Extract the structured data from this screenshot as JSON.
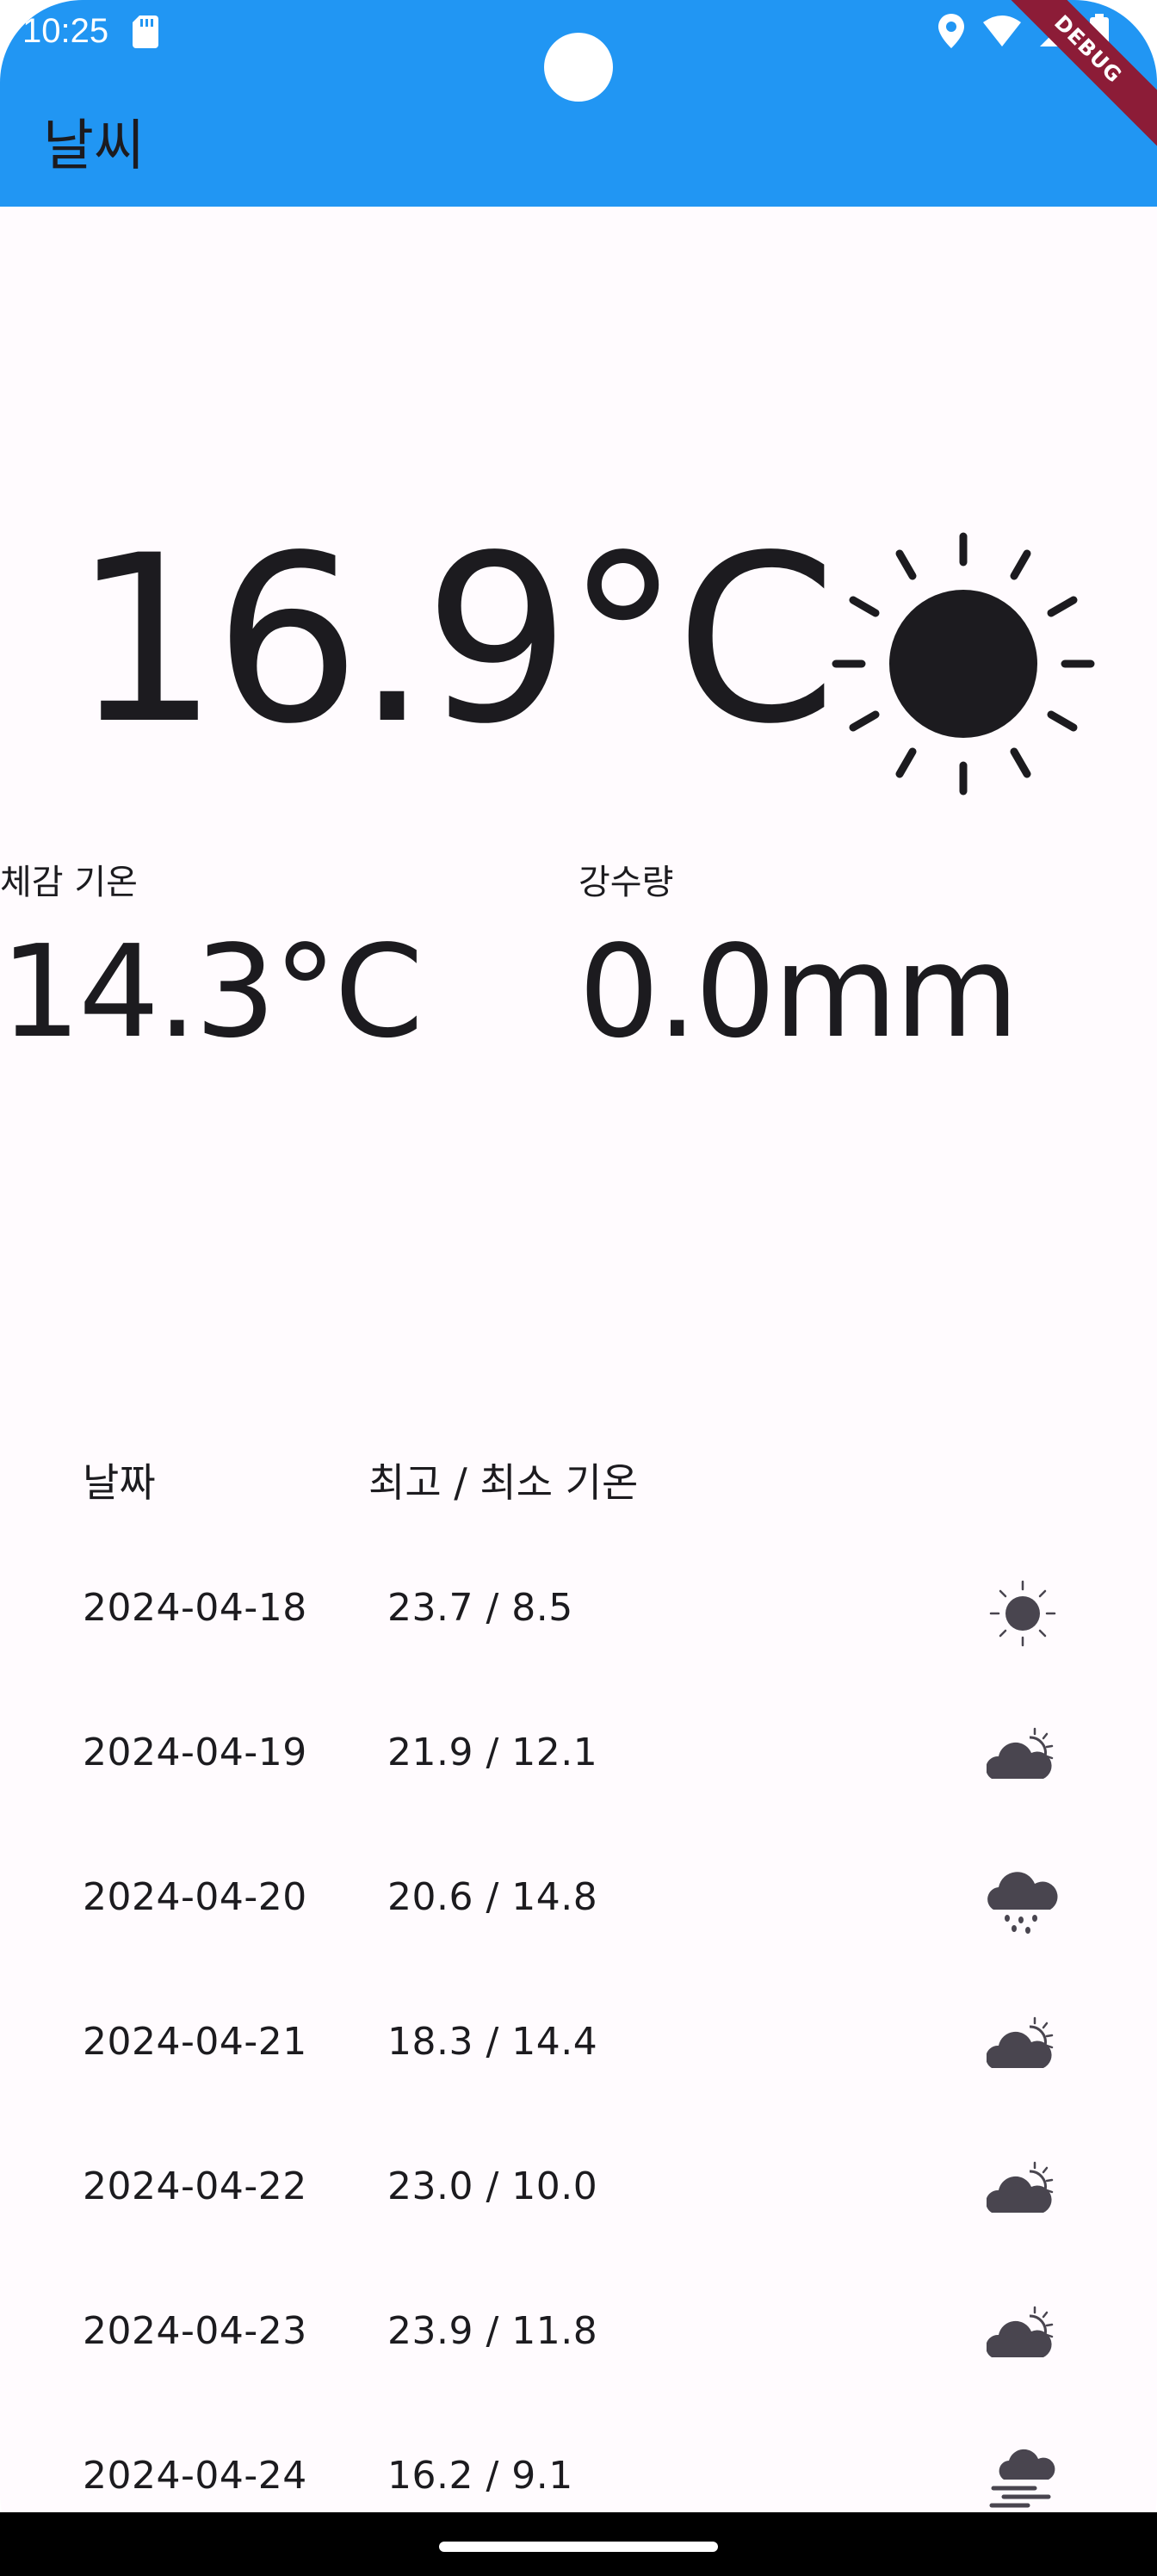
{
  "status_bar": {
    "time": "10:25",
    "icons": [
      "sd-card-icon",
      "location-icon",
      "wifi-icon",
      "cell-signal-icon",
      "battery-icon"
    ]
  },
  "app_bar": {
    "title": "날씨",
    "background": "#2196f3",
    "debug_banner": "DEBUG"
  },
  "current": {
    "temperature": "16.9°C",
    "condition_icon": "sun-icon",
    "feels_like_label": "체감 기온",
    "feels_like_value": "14.3°C",
    "precipitation_label": "강수량",
    "precipitation_value": "0.0mm"
  },
  "forecast": {
    "header_date": "날짜",
    "header_temp": "최고 / 최소 기온",
    "rows": [
      {
        "date": "2024-04-18",
        "temps": "23.7 / 8.5",
        "icon": "sun-icon"
      },
      {
        "date": "2024-04-19",
        "temps": "21.9 / 12.1",
        "icon": "partly-cloudy-icon"
      },
      {
        "date": "2024-04-20",
        "temps": "20.6 / 14.8",
        "icon": "rain-cloud-icon"
      },
      {
        "date": "2024-04-21",
        "temps": "18.3 / 14.4",
        "icon": "partly-cloudy-icon"
      },
      {
        "date": "2024-04-22",
        "temps": "23.0 / 10.0",
        "icon": "partly-cloudy-icon"
      },
      {
        "date": "2024-04-23",
        "temps": "23.9 / 11.8",
        "icon": "partly-cloudy-icon"
      },
      {
        "date": "2024-04-24",
        "temps": "16.2 / 9.1",
        "icon": "fog-cloud-icon"
      }
    ]
  },
  "colors": {
    "appbar": "#2196f3",
    "text": "#1c1b1f",
    "icon": "#49454f",
    "background": "#fffbfe"
  }
}
